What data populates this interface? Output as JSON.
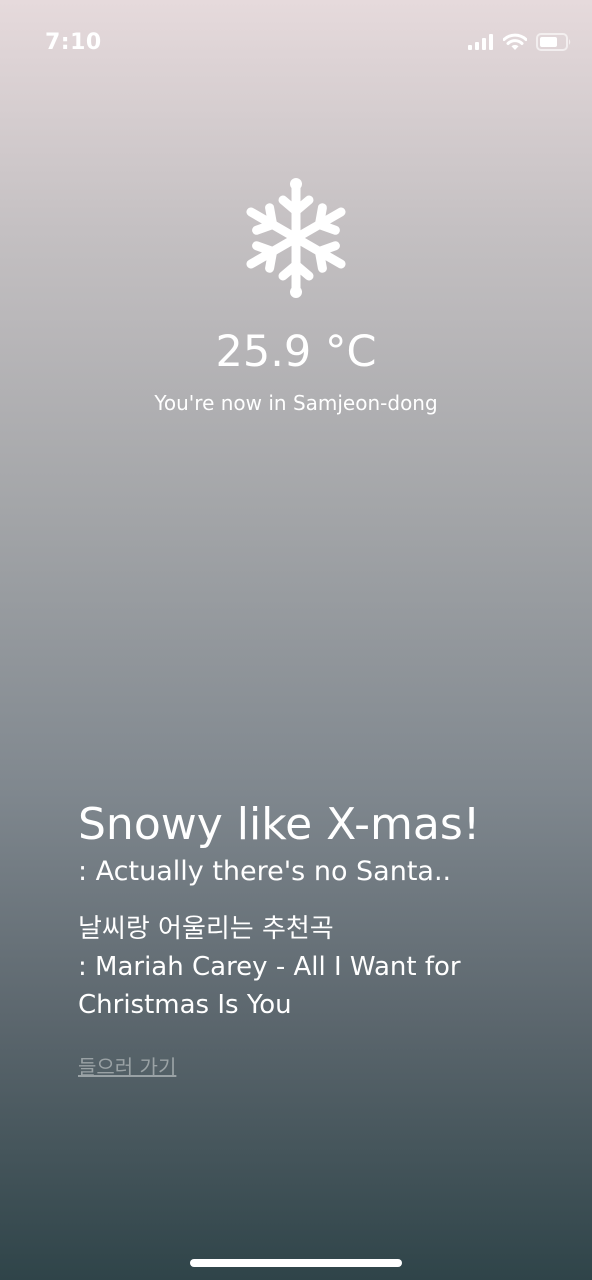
{
  "status_bar": {
    "time": "7:10",
    "icons": [
      "cellular-signal-icon",
      "wifi-icon",
      "battery-icon"
    ]
  },
  "weather": {
    "icon": "snowflake-icon",
    "temperature": "25.9 °C",
    "location_text": "You're now in Samjeon-dong"
  },
  "message": {
    "headline": "Snowy like X-mas!",
    "subtitle": " : Actually there's no Santa..",
    "recommend_label": "날씨랑 어울리는 추천곡",
    "recommend_song": " : Mariah Carey - All I Want for Christmas Is You",
    "listen_link": "들으러 가기"
  },
  "colors": {
    "gradient_top": "#e6dadc",
    "gradient_bottom": "#2f4449",
    "text": "#ffffff",
    "link": "#9aa2a5"
  }
}
